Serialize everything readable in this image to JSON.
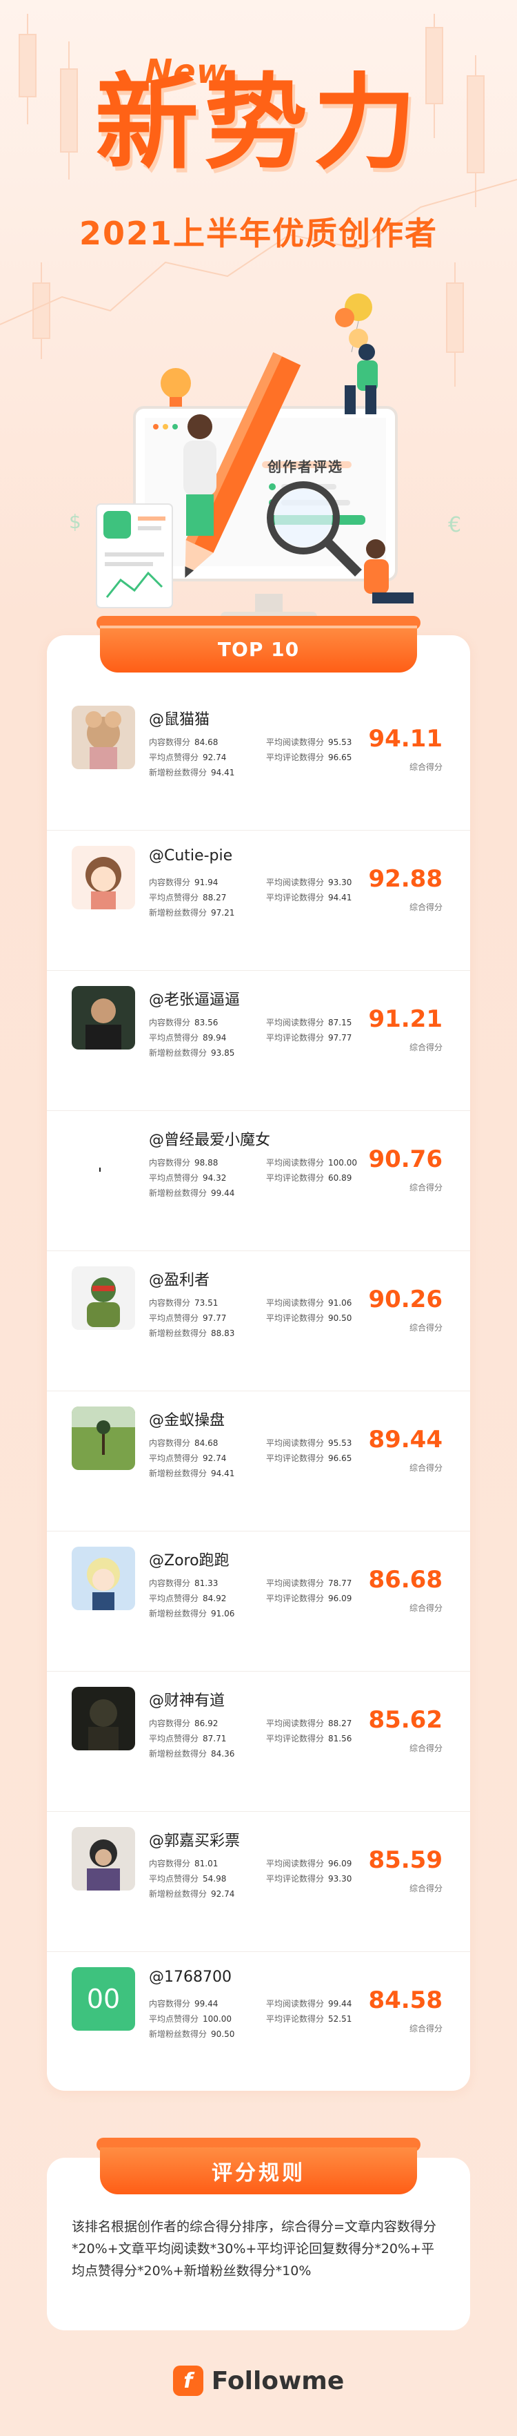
{
  "hero": {
    "new_tag": "New",
    "title": "新势力",
    "subtitle": "2021上半年优质创作者",
    "screen_title": "创作者评选"
  },
  "list": {
    "banner": "TOP 10",
    "labels": {
      "content": "内容数得分",
      "likes": "平均点赞得分",
      "fans": "新增粉丝数得分",
      "reads": "平均阅读数得分",
      "comments": "平均评论数得分",
      "score": "综合得分"
    },
    "rows": [
      {
        "name": "@鼠猫猫",
        "content": "84.68",
        "likes": "92.74",
        "fans": "94.41",
        "reads": "95.53",
        "comments": "96.65",
        "score": "94.11",
        "avatar": "mouse-cat"
      },
      {
        "name": "@Cutie-pie",
        "content": "91.94",
        "likes": "88.27",
        "fans": "97.21",
        "reads": "93.30",
        "comments": "94.41",
        "score": "92.88",
        "avatar": "cartoon-girl"
      },
      {
        "name": "@老张逼逼逼",
        "content": "83.56",
        "likes": "89.94",
        "fans": "93.85",
        "reads": "87.15",
        "comments": "97.77",
        "score": "91.21",
        "avatar": "man-portrait"
      },
      {
        "name": "@曾经最爱小魔女",
        "content": "98.88",
        "likes": "94.32",
        "fans": "99.44",
        "reads": "100.00",
        "comments": "60.89",
        "score": "90.76",
        "avatar": "blank"
      },
      {
        "name": "@盈利者",
        "content": "73.51",
        "likes": "97.77",
        "fans": "88.83",
        "reads": "91.06",
        "comments": "90.50",
        "score": "90.26",
        "avatar": "turtle"
      },
      {
        "name": "@金蚁操盘",
        "content": "84.68",
        "likes": "92.74",
        "fans": "94.41",
        "reads": "95.53",
        "comments": "96.65",
        "score": "89.44",
        "avatar": "field"
      },
      {
        "name": "@Zoro跑跑",
        "content": "81.33",
        "likes": "84.92",
        "fans": "91.06",
        "reads": "78.77",
        "comments": "96.09",
        "score": "86.68",
        "avatar": "anime-boy"
      },
      {
        "name": "@财神有道",
        "content": "86.92",
        "likes": "87.71",
        "fans": "84.36",
        "reads": "88.27",
        "comments": "81.56",
        "score": "85.62",
        "avatar": "dark-statue"
      },
      {
        "name": "@郭嘉买彩票",
        "content": "81.01",
        "likes": "54.98",
        "fans": "92.74",
        "reads": "96.09",
        "comments": "93.30",
        "score": "85.59",
        "avatar": "warrior"
      },
      {
        "name": "@1768700",
        "content": "99.44",
        "likes": "100.00",
        "fans": "90.50",
        "reads": "99.44",
        "comments": "52.51",
        "score": "84.58",
        "avatar": "green-00",
        "avatar_text": "00"
      }
    ]
  },
  "rules": {
    "title": "评分规则",
    "text": "该排名根据创作者的综合得分排序，综合得分=文章内容数得分*20%+文章平均阅读数*30%+平均评论回复数得分*20%+平均点赞得分*20%+新增粉丝数得分*10%"
  },
  "footer": {
    "logo_letter": "f",
    "brand": "Followme"
  },
  "colors": {
    "accent": "#ff5d14",
    "banner": "#ff7a33",
    "background": "#fde9dd",
    "avatar_green": "#3ec27e"
  }
}
